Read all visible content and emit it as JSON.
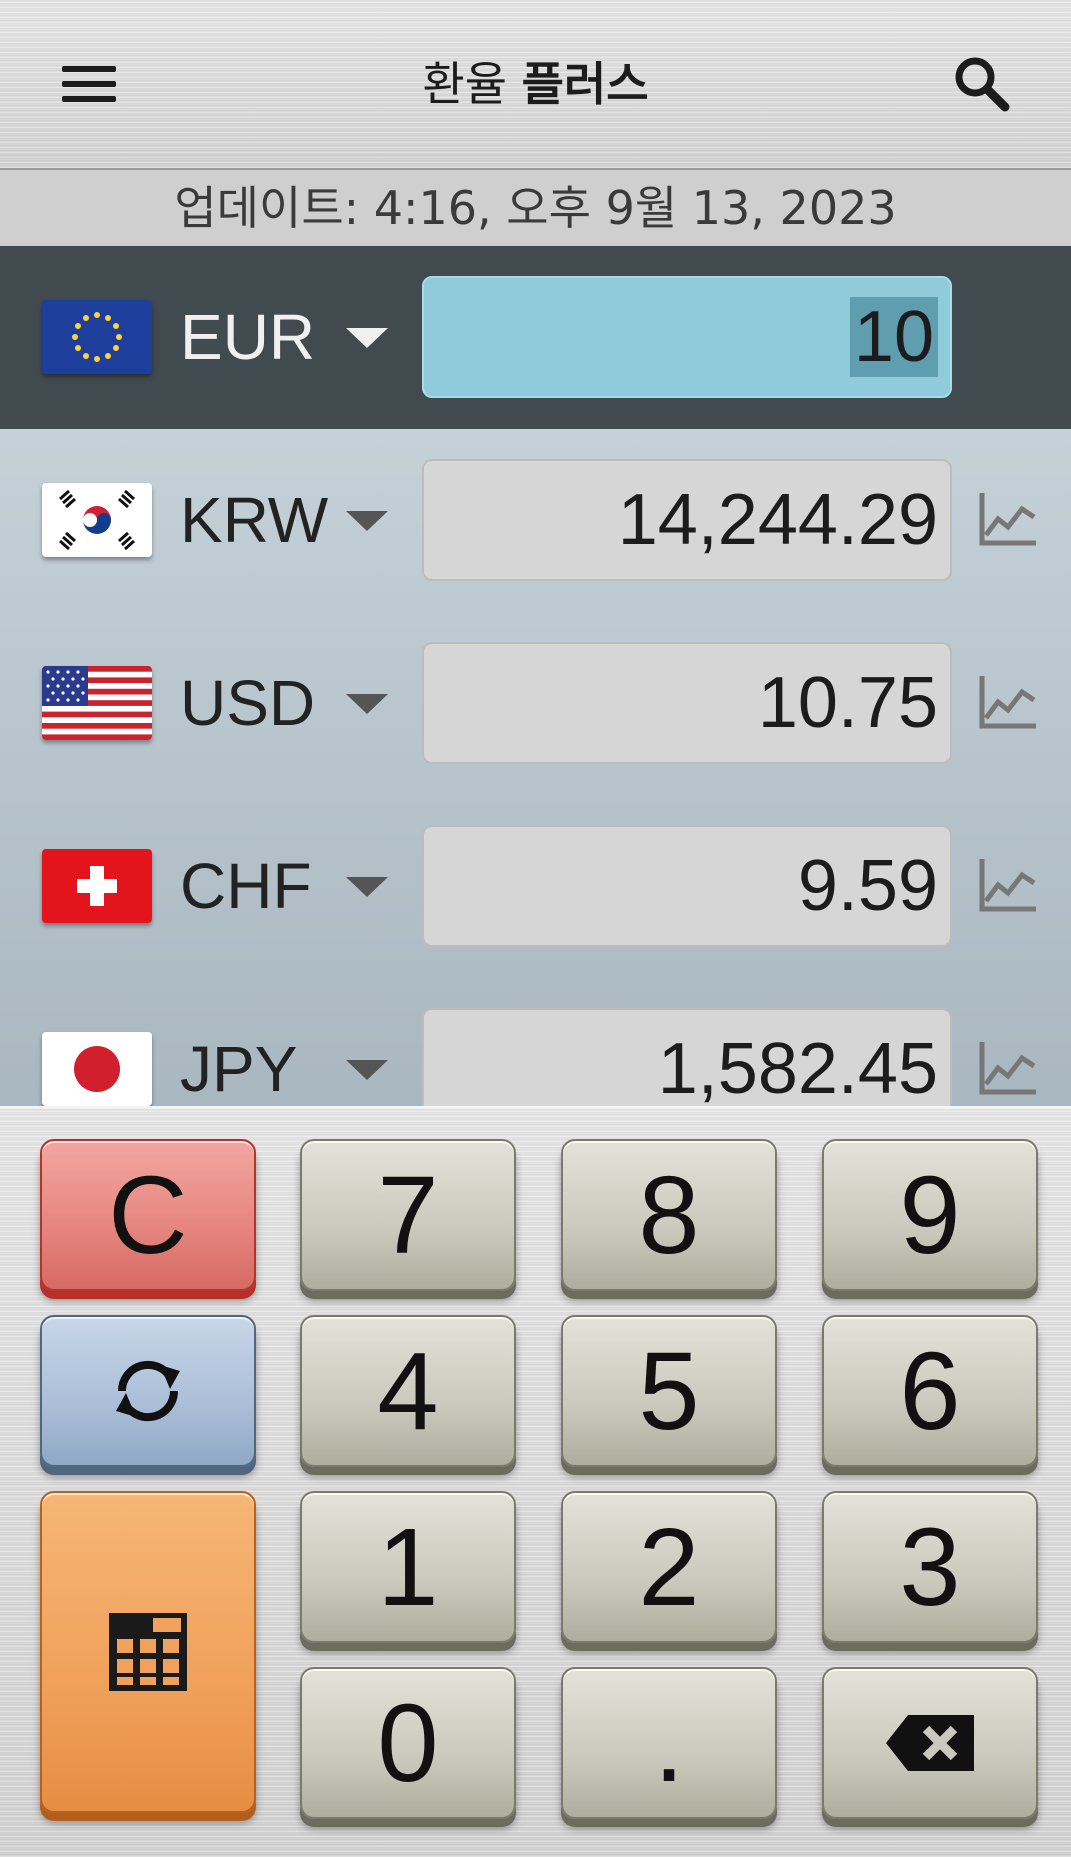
{
  "app": {
    "title_regular": "환율",
    "title_bold": "플러스",
    "update_text": "업데이트: 4:16, 오후 9월 13, 2023"
  },
  "icons": {
    "menu": "menu-icon",
    "search": "search-icon",
    "chart": "trend-chart-icon",
    "swap": "refresh-icon",
    "calculator": "calculator-icon",
    "backspace": "backspace-icon"
  },
  "colors": {
    "base_row": "#414a4f",
    "base_input": "#8fcbdb",
    "clear_key": "#e5857e",
    "swap_key": "#aabed8",
    "calc_key": "#f0a15b"
  },
  "base": {
    "code": "EUR",
    "amount": "10"
  },
  "rows": [
    {
      "code": "KRW",
      "amount": "14,244.29"
    },
    {
      "code": "USD",
      "amount": "10.75"
    },
    {
      "code": "CHF",
      "amount": "9.59"
    },
    {
      "code": "JPY",
      "amount": "1,582.45"
    }
  ],
  "keys": {
    "clear": "C",
    "k7": "7",
    "k8": "8",
    "k9": "9",
    "k4": "4",
    "k5": "5",
    "k6": "6",
    "k1": "1",
    "k2": "2",
    "k3": "3",
    "k0": "0",
    "dot": "."
  }
}
